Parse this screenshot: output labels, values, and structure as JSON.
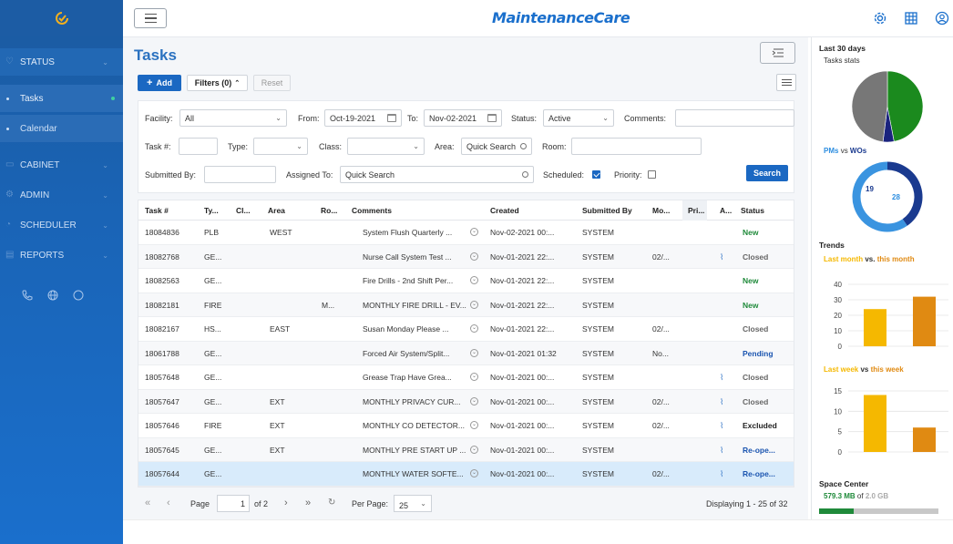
{
  "sidebar": {
    "items": [
      {
        "label": "STATUS"
      },
      {
        "label": "Tasks"
      },
      {
        "label": "Calendar"
      },
      {
        "label": "CABINET"
      },
      {
        "label": "ADMIN"
      },
      {
        "label": "SCHEDULER"
      },
      {
        "label": "REPORTS"
      }
    ]
  },
  "header": {
    "brand": "MaintenanceCare"
  },
  "page": {
    "title": "Tasks"
  },
  "toolbar": {
    "add_label": "Add",
    "filters_label": "Filters (0)",
    "reset_label": "Reset"
  },
  "filters": {
    "facility_label": "Facility:",
    "facility_value": "All",
    "from_label": "From:",
    "from_value": "Oct-19-2021",
    "to_label": "To:",
    "to_value": "Nov-02-2021",
    "status_label": "Status:",
    "status_value": "Active",
    "comments_label": "Comments:",
    "comments_value": "",
    "task_label": "Task #:",
    "task_value": "",
    "type_label": "Type:",
    "type_value": "",
    "class_label": "Class:",
    "class_value": "",
    "area_label": "Area:",
    "area_placeholder": "Quick Search",
    "room_label": "Room:",
    "room_value": "",
    "submitted_label": "Submitted By:",
    "submitted_value": "",
    "assigned_label": "Assigned To:",
    "assigned_placeholder": "Quick Search",
    "scheduled_label": "Scheduled:",
    "scheduled_checked": true,
    "priority_label": "Priority:",
    "priority_checked": false,
    "search_label": "Search"
  },
  "table": {
    "headers": [
      "Task #",
      "Ty...",
      "Cl...",
      "Area",
      "Ro...",
      "Comments",
      "Created",
      "Submitted By",
      "Mo...",
      "Pri...",
      "A...",
      "Status"
    ],
    "rows": [
      {
        "task": "18084836",
        "type": "PLB",
        "cl": "",
        "area": "WEST",
        "ro": "",
        "comments": "System Flush Quarterly ...",
        "created": "Nov-02-2021 00:...",
        "submitted": "SYSTEM",
        "mo": "",
        "attach": false,
        "status": "New",
        "status_kind": "new"
      },
      {
        "task": "18082768",
        "type": "GE...",
        "cl": "",
        "area": "",
        "ro": "",
        "comments": "Nurse Call System Test ...",
        "created": "Nov-01-2021 22:...",
        "submitted": "SYSTEM",
        "mo": "02/...",
        "attach": true,
        "status": "Closed",
        "status_kind": "closed"
      },
      {
        "task": "18082563",
        "type": "GE...",
        "cl": "",
        "area": "",
        "ro": "",
        "comments": "Fire Drills - 2nd Shift Per...",
        "created": "Nov-01-2021 22:...",
        "submitted": "SYSTEM",
        "mo": "",
        "attach": false,
        "status": "New",
        "status_kind": "new"
      },
      {
        "task": "18082181",
        "type": "FIRE",
        "cl": "",
        "area": "",
        "ro": "M...",
        "comments": "MONTHLY FIRE DRILL - EV...",
        "created": "Nov-01-2021 22:...",
        "submitted": "SYSTEM",
        "mo": "",
        "attach": false,
        "status": "New",
        "status_kind": "new"
      },
      {
        "task": "18082167",
        "type": "HS...",
        "cl": "",
        "area": "EAST",
        "ro": "",
        "comments": "Susan Monday Please ...",
        "created": "Nov-01-2021 22:...",
        "submitted": "SYSTEM",
        "mo": "02/...",
        "attach": false,
        "status": "Closed",
        "status_kind": "closed"
      },
      {
        "task": "18061788",
        "type": "GE...",
        "cl": "",
        "area": "",
        "ro": "",
        "comments": "Forced Air System/Split...",
        "created": "Nov-01-2021 01:32",
        "submitted": "SYSTEM",
        "mo": "No...",
        "attach": false,
        "status": "Pending",
        "status_kind": "pending"
      },
      {
        "task": "18057648",
        "type": "GE...",
        "cl": "",
        "area": "",
        "ro": "",
        "comments": "Grease Trap Have Grea...",
        "created": "Nov-01-2021 00:...",
        "submitted": "SYSTEM",
        "mo": "",
        "attach": true,
        "status": "Closed",
        "status_kind": "closed"
      },
      {
        "task": "18057647",
        "type": "GE...",
        "cl": "",
        "area": "EXT",
        "ro": "",
        "comments": "MONTHLY PRIVACY CUR...",
        "created": "Nov-01-2021 00:...",
        "submitted": "SYSTEM",
        "mo": "02/...",
        "attach": true,
        "status": "Closed",
        "status_kind": "closed"
      },
      {
        "task": "18057646",
        "type": "FIRE",
        "cl": "",
        "area": "EXT",
        "ro": "",
        "comments": "MONTHLY CO DETECTOR...",
        "created": "Nov-01-2021 00:...",
        "submitted": "SYSTEM",
        "mo": "02/...",
        "attach": true,
        "status": "Excluded",
        "status_kind": "excluded"
      },
      {
        "task": "18057645",
        "type": "GE...",
        "cl": "",
        "area": "EXT",
        "ro": "",
        "comments": "MONTHLY PRE START UP ...",
        "created": "Nov-01-2021 00:...",
        "submitted": "SYSTEM",
        "mo": "",
        "attach": true,
        "status": "Re-ope...",
        "status_kind": "reopen"
      },
      {
        "task": "18057644",
        "type": "GE...",
        "cl": "",
        "area": "",
        "ro": "",
        "comments": "MONTHLY WATER SOFTE...",
        "created": "Nov-01-2021 00:...",
        "submitted": "SYSTEM",
        "mo": "02/...",
        "attach": true,
        "status": "Re-ope...",
        "status_kind": "reopen"
      }
    ]
  },
  "pager": {
    "page_label": "Page",
    "page_value": "1",
    "of_label": "of 2",
    "per_page_label": "Per Page:",
    "per_page_value": "25",
    "displaying": "Displaying 1 - 25 of 32"
  },
  "right_panel": {
    "last30_title": "Last 30 days",
    "stats_title": "Tasks stats",
    "pms_label": "PMs",
    "vs_label": "vs",
    "wos_label": "WOs",
    "pms_count": "19",
    "wos_count": "28",
    "trends_title": "Trends",
    "last_month_label": "Last month",
    "vs2": "vs.",
    "this_month_label": "this month",
    "last_week_label": "Last week",
    "vs3": "vs",
    "this_week_label": "this week",
    "space_title": "Space Center",
    "space_used": "579.3 MB",
    "space_of": "of",
    "space_total": "2.0 GB"
  },
  "colors": {
    "brand": "#1a6fcc",
    "add_button": "#1b68c2",
    "status_new": "#1f8a3a",
    "bar_last": "#f5b800",
    "bar_this": "#e08a12"
  },
  "chart_data": [
    {
      "type": "pie",
      "title": "Tasks stats",
      "values": [
        47,
        5,
        48
      ],
      "colors": [
        "#1b8a1e",
        "#1a237e",
        "#777777"
      ]
    },
    {
      "type": "pie",
      "title": "PMs vs WOs",
      "categories": [
        "PMs",
        "WOs"
      ],
      "values": [
        19,
        28
      ],
      "colors": [
        "#1a3a8f",
        "#3a94e0"
      ]
    },
    {
      "type": "bar",
      "title": "Last month vs. this month",
      "categories": [
        "Last month",
        "this month"
      ],
      "values": [
        24,
        32
      ],
      "ylim": [
        0,
        40
      ],
      "yticks": [
        0,
        10,
        20,
        30,
        40
      ],
      "colors": [
        "#f5b800",
        "#e08a12"
      ]
    },
    {
      "type": "bar",
      "title": "Last week vs this week",
      "categories": [
        "Last week",
        "this week"
      ],
      "values": [
        14,
        6
      ],
      "ylim": [
        0,
        15
      ],
      "yticks": [
        0,
        5,
        10,
        15
      ],
      "colors": [
        "#f5b800",
        "#e08a12"
      ]
    }
  ],
  "space_progress": 0.29
}
